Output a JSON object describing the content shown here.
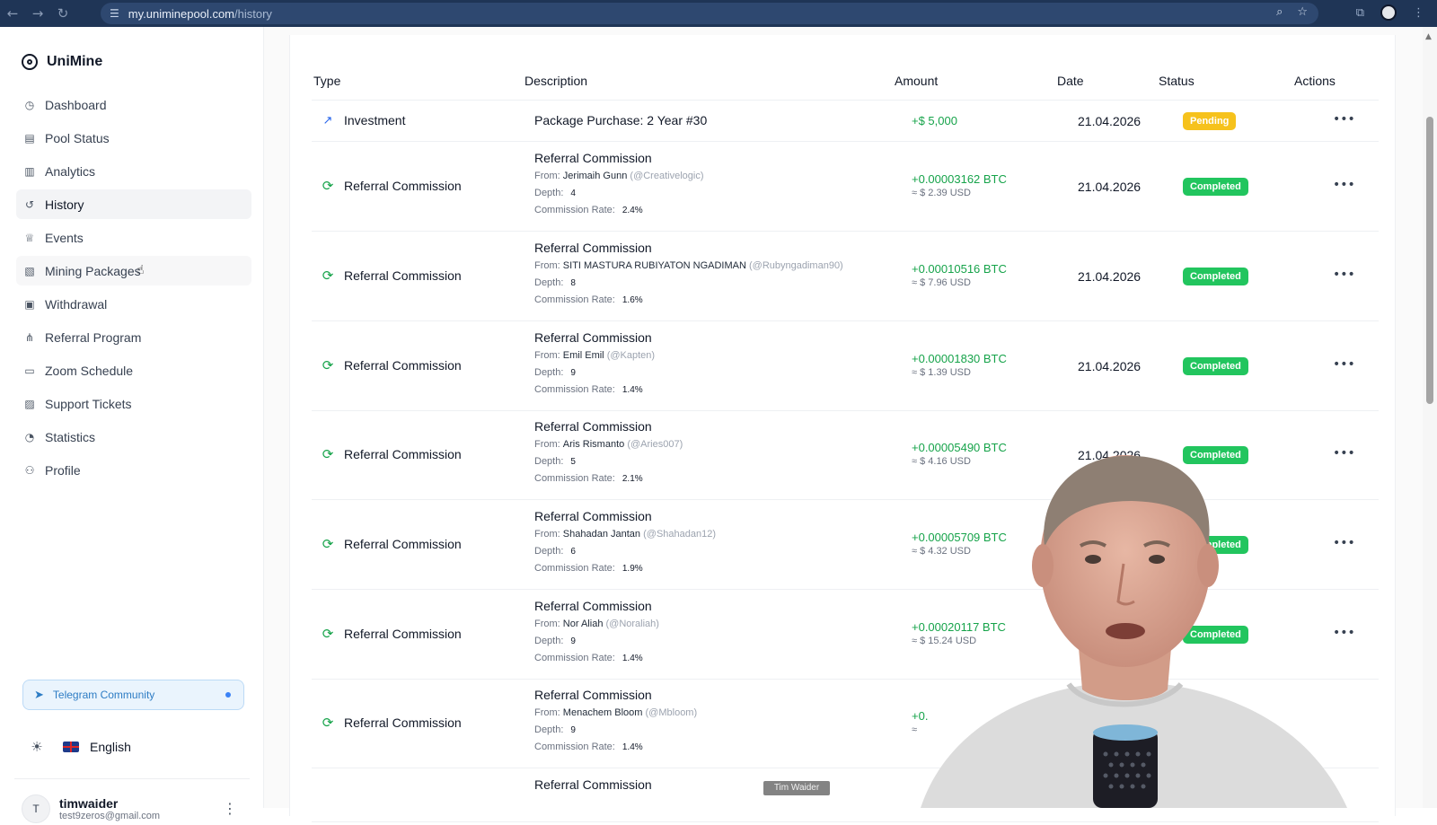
{
  "browser": {
    "url_host": "my.uniminepool.com",
    "url_path": "/history"
  },
  "sidebar": {
    "brand": "UniMine",
    "items": [
      {
        "label": "Dashboard",
        "icon": "dashboard-icon"
      },
      {
        "label": "Pool Status",
        "icon": "server-icon"
      },
      {
        "label": "Analytics",
        "icon": "bar-chart-icon"
      },
      {
        "label": "History",
        "icon": "history-icon"
      },
      {
        "label": "Events",
        "icon": "trophy-icon"
      },
      {
        "label": "Mining Packages",
        "icon": "package-icon"
      },
      {
        "label": "Withdrawal",
        "icon": "wallet-icon"
      },
      {
        "label": "Referral Program",
        "icon": "share-icon"
      },
      {
        "label": "Zoom Schedule",
        "icon": "video-icon"
      },
      {
        "label": "Support Tickets",
        "icon": "ticket-icon"
      },
      {
        "label": "Statistics",
        "icon": "pie-chart-icon"
      },
      {
        "label": "Profile",
        "icon": "users-icon"
      }
    ],
    "active_item": "History",
    "telegram": "Telegram Community",
    "language": "English",
    "user": {
      "initial": "T",
      "name": "timwaider",
      "email": "test9zeros@gmail.com"
    }
  },
  "table": {
    "headers": {
      "type": "Type",
      "description": "Description",
      "amount": "Amount",
      "date": "Date",
      "status": "Status",
      "actions": "Actions"
    },
    "labels": {
      "from": "From:",
      "depth": "Depth:",
      "commission_rate": "Commission Rate:"
    },
    "rows": [
      {
        "type": "Investment",
        "desc_title": "Package Purchase: 2 Year #30",
        "amount": "+$ 5,000",
        "date": "21.04.2026",
        "status": "Pending"
      },
      {
        "type": "Referral Commission",
        "desc_title": "Referral Commission",
        "from_name": "Jerimaih Gunn",
        "from_handle": "(@Creativelogic)",
        "depth": "4",
        "rate": "2.4%",
        "amount": "+0.00003162 BTC",
        "amount_usd": "≈ $ 2.39 USD",
        "date": "21.04.2026",
        "status": "Completed"
      },
      {
        "type": "Referral Commission",
        "desc_title": "Referral Commission",
        "from_name": "SITI MASTURA RUBIYATON NGADIMAN",
        "from_handle": "(@Rubyngadiman90)",
        "depth": "8",
        "rate": "1.6%",
        "amount": "+0.00010516 BTC",
        "amount_usd": "≈ $ 7.96 USD",
        "date": "21.04.2026",
        "status": "Completed"
      },
      {
        "type": "Referral Commission",
        "desc_title": "Referral Commission",
        "from_name": "Emil Emil",
        "from_handle": "(@Kapten)",
        "depth": "9",
        "rate": "1.4%",
        "amount": "+0.00001830 BTC",
        "amount_usd": "≈ $ 1.39 USD",
        "date": "21.04.2026",
        "status": "Completed"
      },
      {
        "type": "Referral Commission",
        "desc_title": "Referral Commission",
        "from_name": "Aris Rismanto",
        "from_handle": "(@Aries007)",
        "depth": "5",
        "rate": "2.1%",
        "amount": "+0.00005490 BTC",
        "amount_usd": "≈ $ 4.16 USD",
        "date": "21.04.2026",
        "status": "Completed"
      },
      {
        "type": "Referral Commission",
        "desc_title": "Referral Commission",
        "from_name": "Shahadan Jantan",
        "from_handle": "(@Shahadan12)",
        "depth": "6",
        "rate": "1.9%",
        "amount": "+0.00005709 BTC",
        "amount_usd": "≈ $ 4.32 USD",
        "date": "",
        "status": "Completed"
      },
      {
        "type": "Referral Commission",
        "desc_title": "Referral Commission",
        "from_name": "Nor Aliah",
        "from_handle": "(@Noraliah)",
        "depth": "9",
        "rate": "1.4%",
        "amount": "+0.00020117 BTC",
        "amount_usd": "≈ $ 15.24 USD",
        "date": "",
        "status": "Completed"
      },
      {
        "type": "Referral Commission",
        "desc_title": "Referral Commission",
        "from_name": "Menachem Bloom",
        "from_handle": "(@Mbloom)",
        "depth": "9",
        "rate": "1.4%",
        "amount": "+0.",
        "amount_usd": "≈",
        "date": "",
        "status": ""
      },
      {
        "type": "",
        "desc_title": "Referral Commission"
      }
    ]
  },
  "webcam": {
    "caption": "Tim Waider"
  },
  "colors": {
    "accent_green": "#16a34a",
    "badge_completed": "#22c55e",
    "badge_pending": "#f6c21c",
    "browser_bar": "#1f3556"
  }
}
